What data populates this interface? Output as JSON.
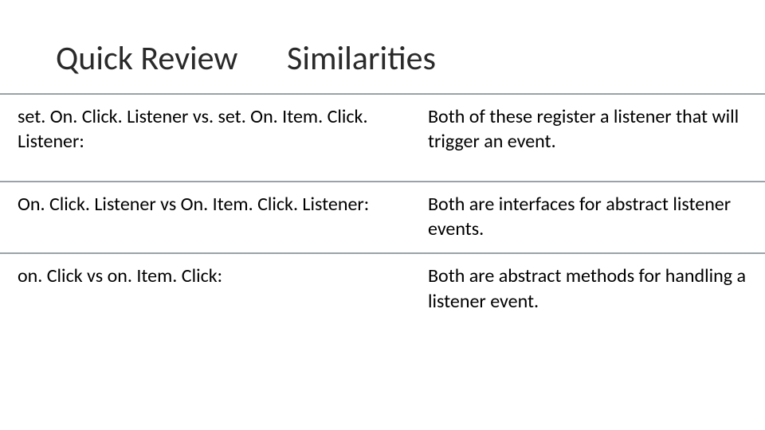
{
  "title": {
    "main": "Quick Review",
    "sub": "Similarities"
  },
  "rows": [
    {
      "left": "set. On. Click. Listener  vs.  set. On. Item. Click. Listener:",
      "right": "Both of these register a listener that will trigger an event."
    },
    {
      "left": "On. Click. Listener vs On. Item. Click. Listener:",
      "right": "Both are interfaces for abstract listener events."
    },
    {
      "left": "on. Click vs on. Item. Click:",
      "right": "Both are abstract methods for handling a listener event."
    }
  ]
}
